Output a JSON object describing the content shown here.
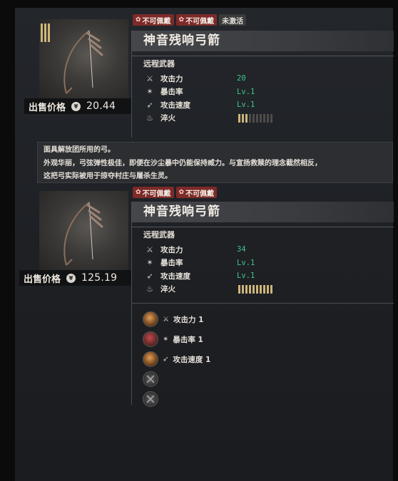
{
  "item1": {
    "tags": [
      {
        "label": "不可佩戴",
        "style": "red"
      },
      {
        "label": "不可佩戴",
        "style": "red"
      },
      {
        "label": "未激活",
        "style": "gray"
      }
    ],
    "name": "神音残响弓箭",
    "type": "远程武器",
    "stats": [
      {
        "icon": "sword-icon",
        "glyph": "⚔",
        "label": "攻击力",
        "value": "20"
      },
      {
        "icon": "crit-icon",
        "glyph": "✶",
        "label": "暴击率",
        "value": "Lv.1"
      },
      {
        "icon": "speed-icon",
        "glyph": "➶",
        "label": "攻击速度",
        "value": "Lv.1"
      },
      {
        "icon": "temper-icon",
        "glyph": "♨",
        "label": "淬火",
        "value": ""
      }
    ],
    "temper_level": 3,
    "temper_max": 10,
    "sell_label": "出售价格",
    "price": "20.44"
  },
  "description": [
    "面具解放团所用的弓。",
    "外观华丽，弓弦弹性极佳，即便在沙尘暴中仍能保持威力。与宣扬救赎的理念截然相反，",
    "这把弓实际被用于掠夺村庄与屠杀生灵。"
  ],
  "item2": {
    "tags": [
      {
        "label": "不可佩戴",
        "style": "red"
      },
      {
        "label": "不可佩戴",
        "style": "red"
      }
    ],
    "name": "神音残响弓箭",
    "type": "远程武器",
    "stats": [
      {
        "icon": "sword-icon",
        "glyph": "⚔",
        "label": "攻击力",
        "value": "34"
      },
      {
        "icon": "crit-icon",
        "glyph": "✶",
        "label": "暴击率",
        "value": "Lv.1"
      },
      {
        "icon": "speed-icon",
        "glyph": "➶",
        "label": "攻击速度",
        "value": "Lv.1"
      },
      {
        "icon": "temper-icon",
        "glyph": "♨",
        "label": "淬火",
        "value": ""
      }
    ],
    "temper_level": 10,
    "temper_max": 10,
    "sell_label": "出售价格",
    "price": "125.19",
    "sockets": [
      {
        "style": "amber",
        "icon": "sword-icon",
        "glyph": "⚔",
        "label": "攻击力 1"
      },
      {
        "style": "red",
        "icon": "crit-icon",
        "glyph": "✶",
        "label": "暴击率 1"
      },
      {
        "style": "amber",
        "icon": "speed-icon",
        "glyph": "➶",
        "label": "攻击速度 1"
      },
      {
        "style": "empty",
        "icon": "",
        "glyph": "",
        "label": ""
      },
      {
        "style": "empty",
        "icon": "",
        "glyph": "",
        "label": ""
      }
    ]
  },
  "coin_glyph": "¥"
}
